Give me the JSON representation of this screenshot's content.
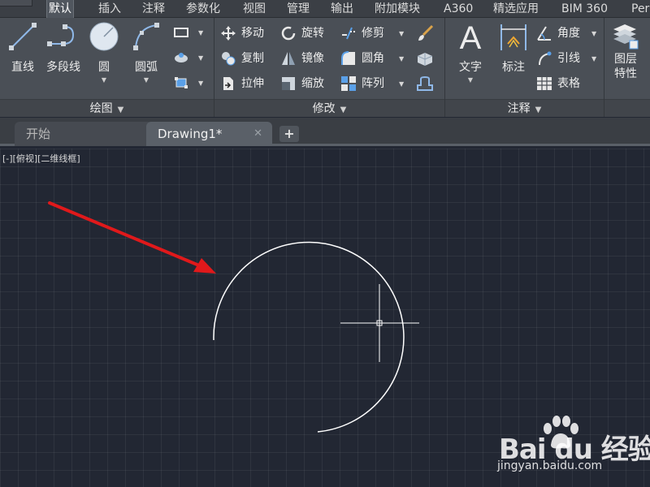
{
  "menubar": {
    "tabs": [
      {
        "label": "默认",
        "active": true
      },
      {
        "label": "插入"
      },
      {
        "label": "注释"
      },
      {
        "label": "参数化"
      },
      {
        "label": "视图"
      },
      {
        "label": "管理"
      },
      {
        "label": "输出"
      },
      {
        "label": "附加模块"
      },
      {
        "label": "A360"
      },
      {
        "label": "精选应用"
      },
      {
        "label": "BIM 360"
      },
      {
        "label": "Per"
      }
    ]
  },
  "ribbon": {
    "draw_panel": {
      "title": "绘图",
      "tools": {
        "line": "直线",
        "polyline": "多段线",
        "circle": "圆",
        "arc": "圆弧"
      }
    },
    "modify_panel": {
      "title": "修改",
      "tools": {
        "move": "移动",
        "rotate": "旋转",
        "trim": "修剪",
        "copy": "复制",
        "mirror": "镜像",
        "fillet": "圆角",
        "stretch": "拉伸",
        "scale": "缩放",
        "array": "阵列"
      }
    },
    "annotate_panel": {
      "title": "注释",
      "tools": {
        "text": "文字",
        "dimension": "标注",
        "angle": "角度",
        "leader": "引线",
        "table": "表格"
      }
    },
    "layers_panel": {
      "tools": {
        "layer_properties_line1": "图层",
        "layer_properties_line2": "特性"
      }
    }
  },
  "tabs": {
    "start": "开始",
    "drawing": "Drawing1*",
    "close_glyph": "✕",
    "add_glyph": "+"
  },
  "canvas": {
    "viewport_label": "[-][俯视][二维线框]"
  },
  "watermark": {
    "brand": "Bai du 经验",
    "url": "jingyan.baidu.com"
  },
  "colors": {
    "canvas_bg": "#222733",
    "ribbon_bg": "#4a4f56",
    "arrow_red": "#e0191b",
    "drawing_white": "#ffffff",
    "circle_tool_fill": "#dfe7f0",
    "accent_blue": "#5aa0e8"
  }
}
